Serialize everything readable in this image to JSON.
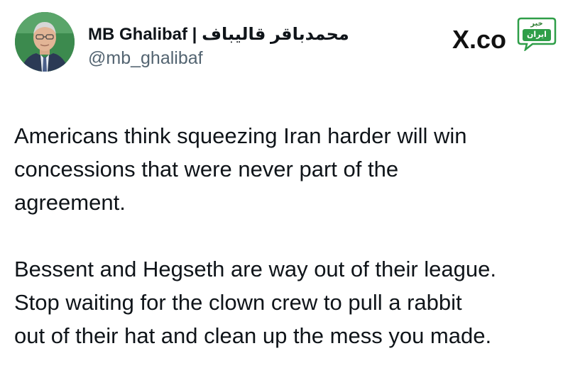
{
  "author": {
    "display_name": "MB Ghalibaf | محمدباقر قالیباف",
    "handle": "@mb_ghalibaf",
    "avatar": "profile-photo"
  },
  "watermark": {
    "site": "X.co",
    "badge_top": "خبر",
    "badge_main": "ایران",
    "badge_color": "#2e9e48"
  },
  "tweet": {
    "paragraph_1": "Americans think squeezing Iran harder will win\nconcessions that were never part of the\nagreement.",
    "paragraph_2": "Bessent and Hegseth are way out of their league.\nStop waiting for the clown crew to pull a rabbit\nout of their hat and clean up the mess you made."
  },
  "colors": {
    "text": "#0f1419",
    "secondary_text": "#536471",
    "background": "#ffffff"
  }
}
